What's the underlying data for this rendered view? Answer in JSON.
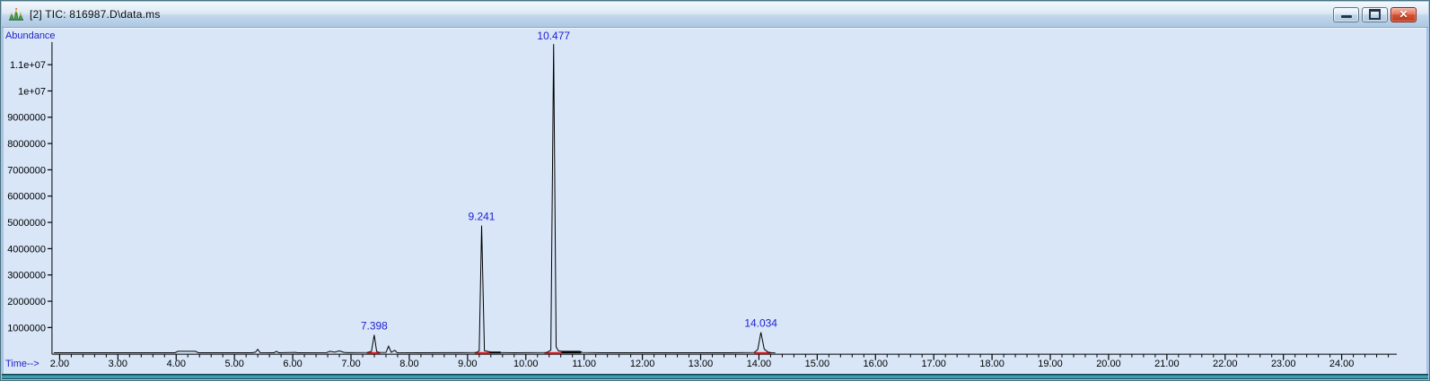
{
  "window": {
    "title": "[2] TIC: 816987.D\\data.ms",
    "icon": "chromatogram-icon",
    "minimize_tooltip": "Minimize",
    "restore_tooltip": "Restore",
    "close_tooltip": "Close",
    "close_glyph": "✕"
  },
  "colors": {
    "chart_background": "#d8e6f8",
    "axis": "#000000",
    "axis_title_blue": "#2222cc",
    "peak_label_blue": "#2121cf",
    "integration_mark_red": "#e01010",
    "titlebar_text": "#0d0d0d",
    "close_button_red": "#d4512f",
    "window_border_teal": "#2e93a3"
  },
  "chart_data": {
    "type": "line",
    "title": "TIC: 816987.D\\data.ms",
    "ylabel": "Abundance",
    "xlabel": "Time-->",
    "xlim": [
      1.9,
      24.9
    ],
    "ylim": [
      0,
      11900000
    ],
    "grid": false,
    "legend": false,
    "x_minor_step": 0.2,
    "x_minor_end": 24.8,
    "x_ticks": [
      {
        "t": 2,
        "label": "2.00"
      },
      {
        "t": 3,
        "label": "3.00"
      },
      {
        "t": 4,
        "label": "4.00"
      },
      {
        "t": 5,
        "label": "5.00"
      },
      {
        "t": 6,
        "label": "6.00"
      },
      {
        "t": 7,
        "label": "7.00"
      },
      {
        "t": 8,
        "label": "8.00"
      },
      {
        "t": 9,
        "label": "9.00"
      },
      {
        "t": 10,
        "label": "10.00"
      },
      {
        "t": 11,
        "label": "11.00"
      },
      {
        "t": 12,
        "label": "12.00"
      },
      {
        "t": 13,
        "label": "13.00"
      },
      {
        "t": 14,
        "label": "14.00"
      },
      {
        "t": 15,
        "label": "15.00"
      },
      {
        "t": 16,
        "label": "16.00"
      },
      {
        "t": 17,
        "label": "17.00"
      },
      {
        "t": 18,
        "label": "18.00"
      },
      {
        "t": 19,
        "label": "19.00"
      },
      {
        "t": 20,
        "label": "20.00"
      },
      {
        "t": 21,
        "label": "21.00"
      },
      {
        "t": 22,
        "label": "22.00"
      },
      {
        "t": 23,
        "label": "23.00"
      },
      {
        "t": 24,
        "label": "24.00"
      }
    ],
    "y_ticks": [
      {
        "v": 1000000,
        "label": "1000000"
      },
      {
        "v": 2000000,
        "label": "2000000"
      },
      {
        "v": 3000000,
        "label": "3000000"
      },
      {
        "v": 4000000,
        "label": "4000000"
      },
      {
        "v": 5000000,
        "label": "5000000"
      },
      {
        "v": 6000000,
        "label": "6000000"
      },
      {
        "v": 7000000,
        "label": "7000000"
      },
      {
        "v": 8000000,
        "label": "8000000"
      },
      {
        "v": 9000000,
        "label": "9000000"
      },
      {
        "v": 10000000,
        "label": "1e+07"
      },
      {
        "v": 11000000,
        "label": "1.1e+07"
      }
    ],
    "peaks": [
      {
        "rt": 7.398,
        "label": "7.398",
        "abundance": 720000
      },
      {
        "rt": 9.241,
        "label": "9.241",
        "abundance": 4880000
      },
      {
        "rt": 10.477,
        "label": "10.477",
        "abundance": 11780000
      },
      {
        "rt": 14.034,
        "label": "14.034",
        "abundance": 820000
      }
    ],
    "integration_marks": [
      {
        "from": 7.27,
        "to": 7.5
      },
      {
        "from": 9.12,
        "to": 9.38
      },
      {
        "from": 10.32,
        "to": 10.61
      },
      {
        "from": 13.92,
        "to": 14.2
      }
    ],
    "baseline_segments": [
      {
        "from": 9.38,
        "to": 9.57
      },
      {
        "from": 10.61,
        "to": 10.95
      }
    ],
    "trace": [
      [
        1.9,
        40000
      ],
      [
        3.98,
        40000
      ],
      [
        4.03,
        95000
      ],
      [
        4.33,
        95000
      ],
      [
        4.38,
        40000
      ],
      [
        5.3,
        40000
      ],
      [
        5.36,
        60000
      ],
      [
        5.4,
        170000
      ],
      [
        5.44,
        45000
      ],
      [
        5.68,
        40000
      ],
      [
        5.72,
        90000
      ],
      [
        5.76,
        40000
      ],
      [
        6.05,
        55000
      ],
      [
        6.08,
        40000
      ],
      [
        6.58,
        45000
      ],
      [
        6.64,
        95000
      ],
      [
        6.72,
        60000
      ],
      [
        6.8,
        110000
      ],
      [
        6.88,
        55000
      ],
      [
        6.95,
        45000
      ],
      [
        7.28,
        50000
      ],
      [
        7.35,
        90000
      ],
      [
        7.398,
        720000
      ],
      [
        7.44,
        95000
      ],
      [
        7.48,
        50000
      ],
      [
        7.6,
        50000
      ],
      [
        7.645,
        290000
      ],
      [
        7.69,
        55000
      ],
      [
        7.75,
        135000
      ],
      [
        7.79,
        45000
      ],
      [
        8.2,
        40000
      ],
      [
        8.9,
        45000
      ],
      [
        9.15,
        50000
      ],
      [
        9.2,
        110000
      ],
      [
        9.241,
        4880000
      ],
      [
        9.29,
        120000
      ],
      [
        9.35,
        90000
      ],
      [
        9.42,
        50000
      ],
      [
        9.8,
        40000
      ],
      [
        10.36,
        50000
      ],
      [
        10.43,
        140000
      ],
      [
        10.477,
        11780000
      ],
      [
        10.52,
        260000
      ],
      [
        10.56,
        110000
      ],
      [
        10.62,
        95000
      ],
      [
        10.93,
        95000
      ],
      [
        10.97,
        50000
      ],
      [
        11.3,
        40000
      ],
      [
        13.5,
        40000
      ],
      [
        13.92,
        50000
      ],
      [
        13.98,
        160000
      ],
      [
        14.034,
        820000
      ],
      [
        14.09,
        180000
      ],
      [
        14.16,
        60000
      ],
      [
        14.22,
        40000
      ],
      [
        14.28,
        35000
      ]
    ]
  }
}
